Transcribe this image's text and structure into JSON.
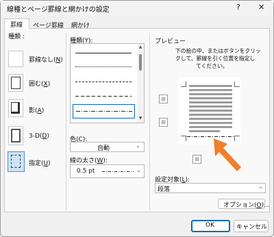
{
  "dialog": {
    "title": "線種とページ罫線と網かけの設定",
    "help": "?",
    "close": "✕"
  },
  "tabs": [
    {
      "label": "罫線"
    },
    {
      "label": "ページ罫線"
    },
    {
      "label": "網かけ"
    }
  ],
  "settings": {
    "label": "種類 :",
    "items": [
      {
        "text": "罫線なし(",
        "key": "N",
        "close": ")"
      },
      {
        "text": "囲む(",
        "key": "X",
        "close": ")"
      },
      {
        "text": "影(",
        "key": "A",
        "close": ")"
      },
      {
        "text": "3-D(",
        "key": "D",
        "close": ")"
      },
      {
        "text": "指定(",
        "key": "U",
        "close": ")"
      }
    ]
  },
  "style": {
    "label": "種類(",
    "key": "Y",
    "close": "):"
  },
  "color": {
    "label": "色(",
    "key": "C",
    "close": "):",
    "value": "自動"
  },
  "width": {
    "label": "線の太さ(",
    "key": "W",
    "close": "):",
    "value": "0.5 pt"
  },
  "preview": {
    "label": "プレビュー",
    "instruction_line1": "下の絵の中、またはボタンをクリッ",
    "instruction_line2": "クして、罫線を引く位置を指定し",
    "instruction_line3": "てください。"
  },
  "apply_to": {
    "label": "設定対象(",
    "key": "L",
    "close": "):",
    "value": "段落"
  },
  "buttons": {
    "options_text": "オプション(",
    "options_key": "O",
    "options_close": ")...",
    "ok": "OK",
    "cancel": "キャンセル"
  },
  "colors": {
    "accent": "#0067c0",
    "arrow": "#f07f2d",
    "selection": "#cce4f7"
  }
}
